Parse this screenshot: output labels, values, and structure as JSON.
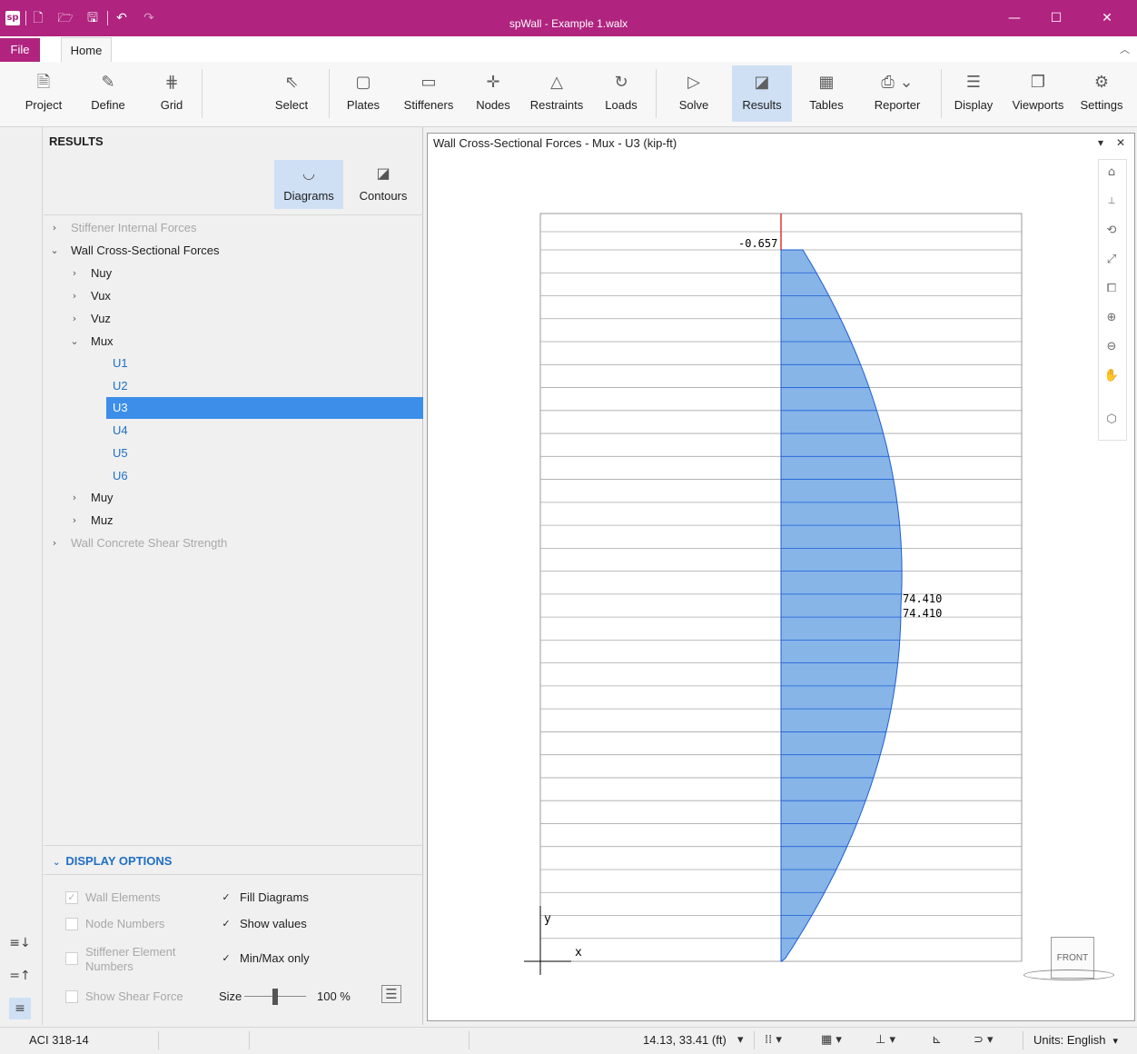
{
  "window": {
    "title": "spWall - Example 1.walx",
    "logo": "sp",
    "controls": [
      "minimize-icon",
      "maximize-icon",
      "close-icon"
    ]
  },
  "tabs": {
    "file": "File",
    "home": "Home"
  },
  "ribbon": {
    "project": "Project",
    "define": "Define",
    "grid": "Grid",
    "select": "Select",
    "plates": "Plates",
    "stiffeners": "Stiffeners",
    "nodes": "Nodes",
    "restraints": "Restraints",
    "loads": "Loads",
    "solve": "Solve",
    "results": "Results",
    "tables": "Tables",
    "reporter": "Reporter",
    "display": "Display",
    "viewports": "Viewports",
    "settings": "Settings",
    "active": "Results"
  },
  "results_panel": {
    "heading": "RESULTS",
    "mode_diagrams": "Diagrams",
    "mode_contours": "Contours",
    "active_mode": "Diagrams",
    "tree": [
      {
        "label": "Stiffener Internal Forces",
        "chevron": ">",
        "dim": true
      },
      {
        "label": "Wall Cross-Sectional Forces",
        "chevron": "v"
      },
      {
        "label": "Nuy",
        "chevron": ">"
      },
      {
        "label": "Vux",
        "chevron": ">"
      },
      {
        "label": "Vuz",
        "chevron": ">"
      },
      {
        "label": "Mux",
        "chevron": "v"
      },
      {
        "label": "U1"
      },
      {
        "label": "U2"
      },
      {
        "label": "U3",
        "selected": true
      },
      {
        "label": "U4"
      },
      {
        "label": "U5"
      },
      {
        "label": "U6"
      },
      {
        "label": "Muy",
        "chevron": ">"
      },
      {
        "label": "Muz",
        "chevron": ">"
      },
      {
        "label": "Wall Concrete Shear Strength",
        "chevron": ">",
        "dim": true
      }
    ],
    "display_options": {
      "heading": "DISPLAY OPTIONS",
      "wall_elements": "Wall Elements",
      "node_numbers": "Node Numbers",
      "stiffener_element_numbers": "Stiffener Element Numbers",
      "show_shear_force": "Show Shear Force",
      "fill_diagrams": "Fill Diagrams",
      "show_values": "Show values",
      "minmax_only": "Min/Max only",
      "size_label": "Size",
      "size_value": "100 %",
      "size_fraction": 0.5
    }
  },
  "viewport": {
    "title": "Wall Cross-Sectional Forces - Mux - U3 (kip-ft)",
    "dropdown": "▾",
    "close": "✕",
    "label_top": "-0.657",
    "label_max_1": "74.410",
    "label_max_2": "74.410",
    "axis_y": "y",
    "axis_x": "x",
    "viewcube": "FRONT",
    "accent_fill": "#87b5e8",
    "accent_line": "#1b5fd6"
  },
  "status": {
    "code": "ACI 318-14",
    "coords": "14.13, 33.41 (ft)",
    "units": "Units:  English"
  }
}
